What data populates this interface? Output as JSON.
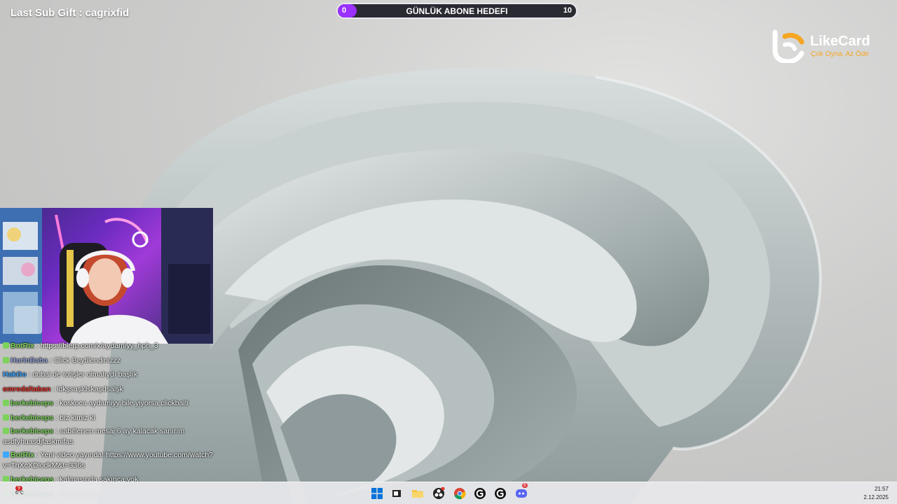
{
  "overlay": {
    "last_sub_text": "Last Sub Gift : cagrixfid",
    "goal": {
      "title": "GÜNLÜK ABONE HEDEFI",
      "current": "0",
      "target": "10",
      "progress": 0
    },
    "sponsor": {
      "name": "LikeCard",
      "tagline": "Çok Oyna, Az Öde",
      "accent": "#f5a623"
    }
  },
  "chat": [
    {
      "badge": "mod",
      "user": "BotRix",
      "user_color": "#7cd35b",
      "message": "https://blerp.com/x/aydamiyy_hph_3"
    },
    {
      "badge": "mod",
      "user": "HurinBaba",
      "user_color": "#9aa6d8",
      "message": "Click Beytilendinizzz"
    },
    {
      "badge": "",
      "user": "HakGo",
      "user_color": "#3fa7ff",
      "message": "dubai de totişler olmalıydı başlık"
    },
    {
      "badge": "",
      "user": "emredaltaban",
      "user_color": "#e0332b",
      "message": "ldkşsaşldskaşdsalşk"
    },
    {
      "badge": "mod",
      "user": "berkebiceps",
      "user_color": "#7cd35b",
      "message": "koskoca aydamiyy bile yiyorsa clickbaiti"
    },
    {
      "badge": "mod",
      "user": "berkebiceps",
      "user_color": "#7cd35b",
      "message": "biz kimiz ki"
    },
    {
      "badge": "mod",
      "user": "berkebiceps",
      "user_color": "#7cd35b",
      "message": "sabitlenen mesaj 6 ay kalacak sanırım asdfyhuasdjfaskmifas"
    },
    {
      "badge": "bot",
      "user": "BotRix",
      "user_color": "#7cd35b",
      "message": "Yeni video yayında! https://www.youtube.com/watch?v=ThXcXDlodkM&t=336s"
    },
    {
      "badge": "mod",
      "user": "berkebiceps",
      "user_color": "#7cd35b",
      "message": "kalmasında sakınca yok"
    },
    {
      "badge": "mod",
      "user": "berkebiceps",
      "user_color": "#7cd35b",
      "message": "asdfjuaskfsa"
    }
  ],
  "taskbar": {
    "weather_badge": "9",
    "temperature": "6°C",
    "time": "21:57",
    "date": "2.12.2025",
    "discord_badge": "6",
    "icons": [
      "windows-start-icon",
      "task-view-icon",
      "file-explorer-icon",
      "obs-icon",
      "chrome-icon",
      "grok-icon",
      "grok-icon-2",
      "discord-icon"
    ]
  }
}
